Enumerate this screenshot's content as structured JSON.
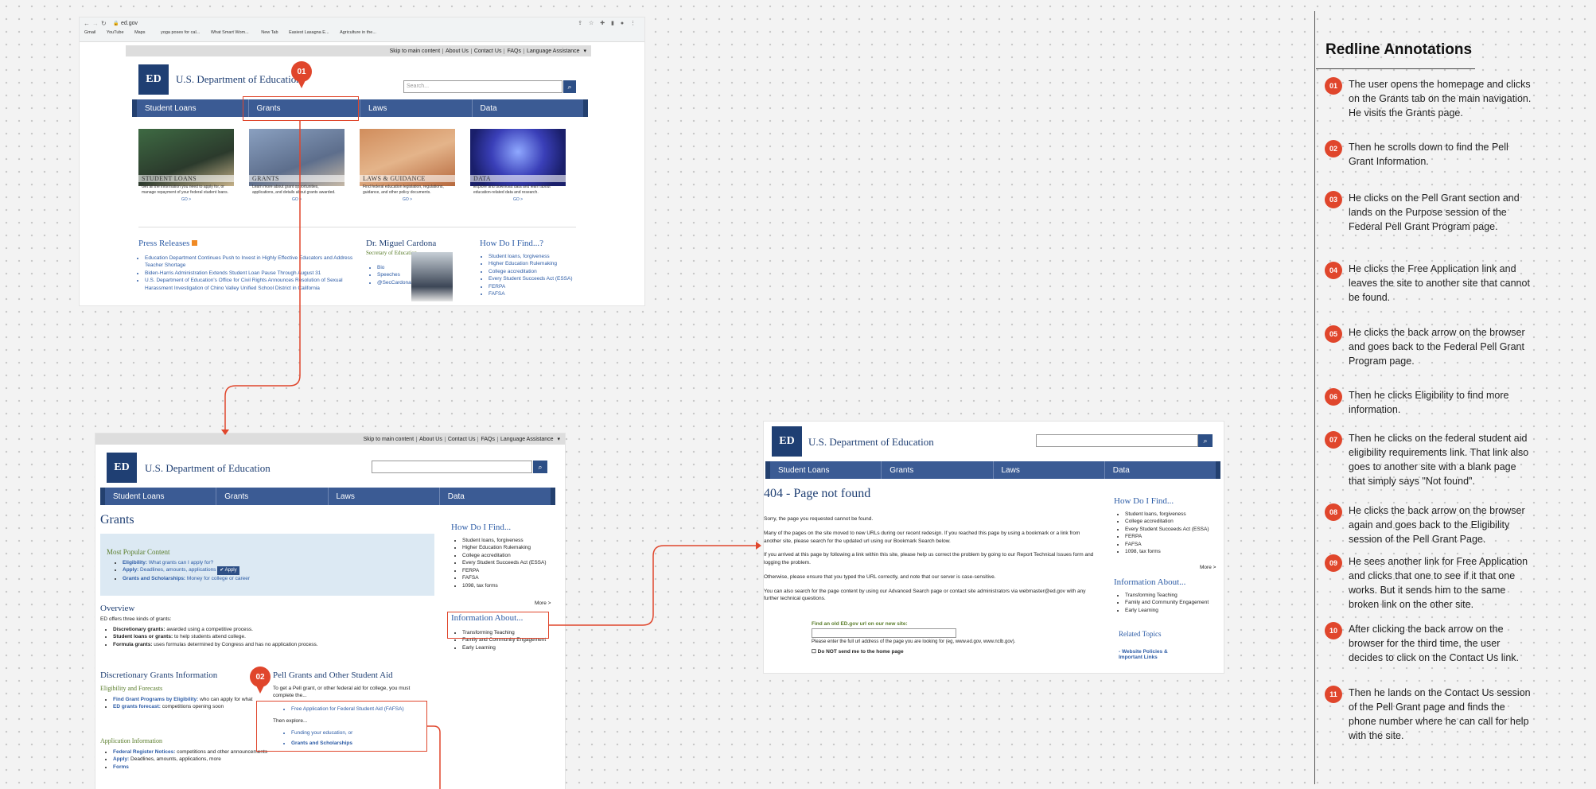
{
  "browser": {
    "url": "ed.gov",
    "bookmarks": [
      "Gmail",
      "YouTube",
      "Maps",
      "yoga poses for cal...",
      "What Smart Wom...",
      "New Tab",
      "Easiest Lasagna E...",
      "Agriculture in the..."
    ]
  },
  "site": {
    "title": "U.S. Department of Education",
    "top_links": [
      "Skip to main content",
      "About Us",
      "Contact Us",
      "FAQs",
      "Language Assistance"
    ],
    "search_placeholder": "Search...",
    "nav": [
      "Student Loans",
      "Grants",
      "Laws",
      "Data"
    ]
  },
  "home": {
    "cards": [
      {
        "title": "STUDENT LOANS",
        "desc": "Get all the information you need to apply for, or manage repayment of your federal student loans.",
        "go": "GO >"
      },
      {
        "title": "GRANTS",
        "desc": "Learn more about grant opportunities, applications, and details about grants awarded.",
        "go": "GO >"
      },
      {
        "title": "LAWS & GUIDANCE",
        "desc": "Find federal education legislation, regulations, guidance, and other policy documents.",
        "go": "GO >"
      },
      {
        "title": "DATA",
        "desc": "Explore and download data and learn about education-related data and research.",
        "go": "GO >"
      }
    ],
    "press_title": "Press Releases",
    "press": [
      "Education Department Continues Push to Invest in Highly Effective Educators and Address Teacher Shortage",
      "Biden-Harris Administration Extends Student Loan Pause Through August 31",
      "U.S. Department of Education's Office for Civil Rights Announces Resolution of Sexual Harassment Investigation of Chino Valley Unified School District in California"
    ],
    "secretary_name": "Dr. Miguel Cardona",
    "secretary_role": "Secretary of Education",
    "secretary_links": [
      "Bio",
      "Speeches",
      "@SecCardona"
    ],
    "how_title": "How Do I Find...?",
    "how_links": [
      "Student loans, forgiveness",
      "Higher Education Rulemaking",
      "College accreditation",
      "Every Student Succeeds Act (ESSA)",
      "FERPA",
      "FAFSA"
    ]
  },
  "grants": {
    "title": "Grants",
    "popular_title": "Most Popular Content",
    "popular": [
      {
        "label": "Eligibility:",
        "text": "What grants can I apply for?"
      },
      {
        "label": "Apply:",
        "text": "Deadlines, amounts, applications"
      },
      {
        "label": "Grants and Scholarships:",
        "text": "Money for college or career"
      }
    ],
    "apply_btn": "Apply",
    "overview_title": "Overview",
    "overview_intro": "ED offers three kinds of grants:",
    "overview_items": [
      {
        "label": "Discretionary grants:",
        "text": "awarded using a competitive process."
      },
      {
        "label": "Student loans or grants:",
        "text": "to help students attend college."
      },
      {
        "label": "Formula grants:",
        "text": "uses formulas determined by Congress and has no application process."
      }
    ],
    "disc_title": "Discretionary Grants Information",
    "elig_title": "Eligibility and Forecasts",
    "elig_items": [
      {
        "label": "Find Grant Programs by Eligibility:",
        "text": "who can apply for what"
      },
      {
        "label": "ED grants forecast:",
        "text": "competitions opening soon"
      }
    ],
    "appinfo_title": "Application Information",
    "appinfo_items": [
      {
        "label": "Federal Register Notices:",
        "text": "competitions and other announcements"
      },
      {
        "label": "Apply:",
        "text": "Deadlines, amounts, applications, more"
      },
      {
        "label": "Forms",
        "text": ""
      }
    ],
    "pell_title": "Pell Grants and Other Student Aid",
    "pell_intro": "To get a Pell grant, or other federal aid for college, you must complete the...",
    "pell_fafsa": "Free Application for Federal Student Aid (FAFSA)",
    "pell_then": "Then explore...",
    "pell_funding": "Funding your education, or",
    "pell_scholar": "Grants and Scholarships",
    "how_title": "How Do I Find...",
    "how_links": [
      "Student loans, forgiveness",
      "Higher Education Rulemaking",
      "College accreditation",
      "Every Student Succeeds Act (ESSA)",
      "FERPA",
      "FAFSA",
      "1098, tax forms"
    ],
    "more": "More >",
    "info_title": "Information About...",
    "info_links": [
      "Transforming Teaching",
      "Family and Community Engagement",
      "Early Learning"
    ]
  },
  "notfound": {
    "title": "404 - Page not found",
    "p1": "Sorry, the page you requested cannot be found.",
    "p2": "Many of the pages on the site moved to new URLs during our recent redesign. If you reached this page by using a bookmark or a link from another site, please search for the updated url using our Bookmark Search below.",
    "p3": "If you arrived at this page by following a link within this site, please help us correct the problem by going to our Report Technical Issues form and logging the problem.",
    "p4": "Otherwise, please ensure that you typed the URL correctly, and note that our server is case-sensitive.",
    "p5": "You can also search for the page content by using our Advanced Search page or contact site administrators via webmaster@ed.gov with any further technical questions.",
    "find_label": "Find an old ED.gov url on our new site:",
    "enter_label": "Please enter the full url address of the page you are looking for (eg, www.ed.gov, www.nclb.gov).",
    "donot": "Do NOT send me to the home page",
    "how_title": "How Do I Find...",
    "how_links": [
      "Student loans, forgiveness",
      "College accreditation",
      "Every Student Succeeds Act (ESSA)",
      "FERPA",
      "FAFSA",
      "1098, tax forms"
    ],
    "more": "More >",
    "info_title": "Information About...",
    "info_links": [
      "Transforming Teaching",
      "Family and Community Engagement",
      "Early Learning"
    ],
    "related_title": "Related Topics",
    "related_link": "- Website Policies & Important Links"
  },
  "pins": [
    "01",
    "02"
  ],
  "annotations": {
    "title": "Redline Annotations",
    "items": [
      {
        "num": "01",
        "text": "The user opens the homepage and clicks on the Grants tab on the main navigation. He visits the Grants page."
      },
      {
        "num": "02",
        "text": "Then he scrolls down to find the Pell Grant Information."
      },
      {
        "num": "03",
        "text": "He clicks on the Pell Grant section and lands on the Purpose session of the Federal Pell Grant Program page."
      },
      {
        "num": "04",
        "text": "He clicks the Free Application link and leaves the site to another site that cannot be found."
      },
      {
        "num": "05",
        "text": "He clicks the back arrow on the browser and goes back to the Federal Pell Grant Program page."
      },
      {
        "num": "06",
        "text": "Then he clicks Eligibility to find more information."
      },
      {
        "num": "07",
        "text": "Then he clicks on the federal student aid eligibility requirements link. That link also goes to another site with a blank page that simply says \"Not found\"."
      },
      {
        "num": "08",
        "text": "He clicks the back arrow on the browser again and goes back to the Eligibility session of the Pell Grant Page."
      },
      {
        "num": "09",
        "text": " He sees another link for Free Application and clicks that one to see if it that one works. But it sends him to the same broken link on the other site."
      },
      {
        "num": "10",
        "text": "After clicking the back arrow on the browser for the third time, the user decides to click on the Contact Us link."
      },
      {
        "num": "11",
        "text": "Then he lands on the Contact Us session of the Pell Grant page and finds the phone number where he can call for help with the site."
      }
    ]
  }
}
